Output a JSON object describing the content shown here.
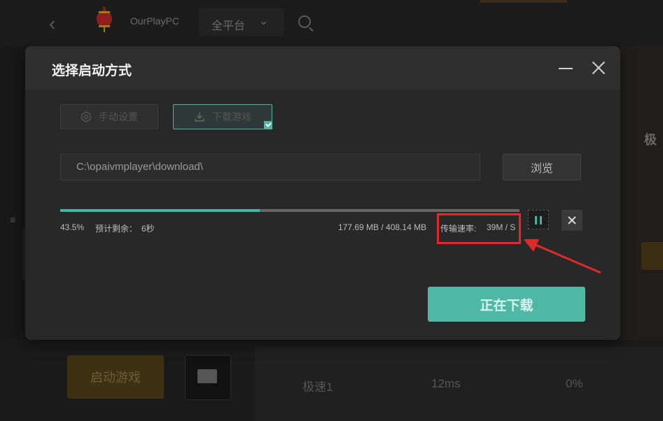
{
  "background": {
    "app_name": "OurPlayPC",
    "platform_filter": "全平台",
    "right_panel_text": "极",
    "launch_button": "启动游戏",
    "stats": {
      "speed_label": "极速1",
      "latency": "12ms",
      "loss": "0%"
    }
  },
  "modal": {
    "title": "选择启动方式",
    "options": {
      "manual": "手动设置",
      "download": "下载游戏"
    },
    "path_value": "C:\\opaivmplayer\\download\\",
    "browse_label": "浏览",
    "progress": {
      "percent_value": 0.435,
      "percent_text": "43.5%",
      "remaining_label": "预计剩余：",
      "remaining_value": "6秒",
      "size_text": "177.69 MB / 408.14 MB",
      "speed_label": "传输速率:",
      "speed_value": "39M / S"
    },
    "main_button": "正在下载"
  },
  "colors": {
    "accent": "#4fb8a4",
    "highlight": "#e02a2a"
  },
  "icons": [
    "back-icon",
    "lantern-logo-icon",
    "chevron-down-icon",
    "search-icon",
    "minimize-icon",
    "close-icon",
    "settings-hex-icon",
    "download-icon",
    "checkmark-icon",
    "pause-icon",
    "folder-icon"
  ]
}
